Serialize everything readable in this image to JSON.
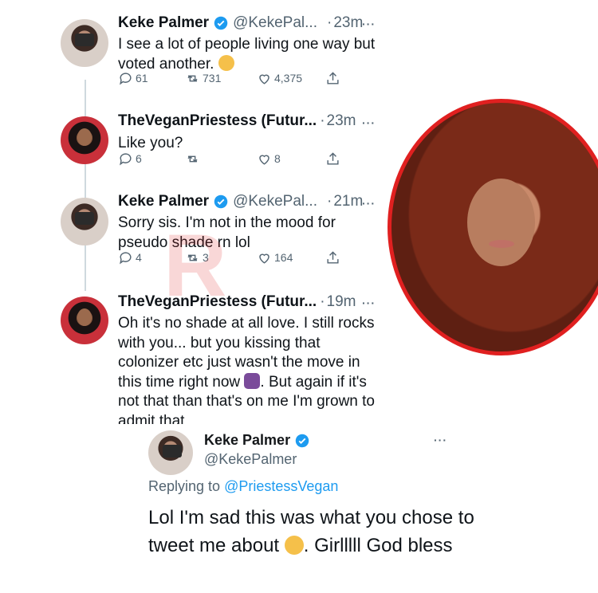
{
  "tweets": [
    {
      "name": "Keke Palmer",
      "handle": "@KekePal...",
      "dot": "·",
      "time": "23m",
      "more": "···",
      "text": "I see a lot of people living one way but voted another.",
      "emoji": "pensive-emoji",
      "replies": "61",
      "retweets": "731",
      "likes": "4,375"
    },
    {
      "name": "TheVeganPriestess (Futur...",
      "dot": "·",
      "time": "23m",
      "more": "···",
      "text": "Like you?",
      "replies": "6",
      "retweets": "",
      "likes": "8"
    },
    {
      "name": "Keke Palmer",
      "handle": "@KekePal...",
      "dot": "·",
      "time": "21m",
      "more": "···",
      "text": "Sorry sis. I'm not in the mood for pseudo shade rn lol",
      "replies": "4",
      "retweets": "3",
      "likes": "164"
    },
    {
      "name": "TheVeganPriestess (Futur...",
      "dot": "·",
      "time": "19m",
      "more": "···",
      "text_before": "Oh it's no shade at all love. I still rocks with you... but you kissing that colonizer etc just wasn't the move in this time right now",
      "emoji": "facepalm-emoji",
      "text_after": ". But again if it's not that than that's on me I'm grown to admit that"
    }
  ],
  "reply": {
    "name": "Keke Palmer",
    "handle": "@KekePalmer",
    "more": "···",
    "replying_prefix": "Replying to",
    "replying_to": "@PriestessVegan",
    "text_before": "Lol I'm sad this was what you chose to tweet me about",
    "emoji": "woozy-emoji",
    "text_after": ". Girlllll God bless"
  },
  "watermark": "R",
  "colors": {
    "accent_red": "#e02020",
    "link_blue": "#1d9bf0",
    "verified_blue": "#1d9bf0",
    "muted": "#536471"
  }
}
